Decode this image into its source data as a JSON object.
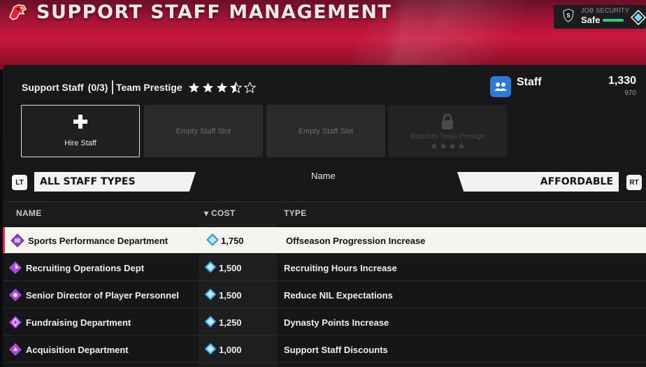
{
  "header": {
    "title": "SUPPORT STAFF MANAGEMENT",
    "job_security": {
      "label": "JOB SECURITY",
      "value": "Safe",
      "bar_level": 0.6,
      "bar_color": "#2fd07a"
    },
    "accent_color": "#c8183f"
  },
  "summary": {
    "staff_label": "Support Staff",
    "staff_count": "(0/3)",
    "prestige_label": "Team Prestige",
    "prestige_stars": 3.5,
    "prestige_max": 5
  },
  "currency": {
    "label": "Staff",
    "icon": "staff-icon",
    "total": "1,330",
    "sub": "970",
    "badge_color": "#2e78d8"
  },
  "slots": [
    {
      "label": "Hire Staff",
      "icon": "plus-icon"
    },
    {
      "label": "Empty Staff Slot"
    },
    {
      "label": "Empty Staff Slot"
    },
    {
      "label": "Requires Team Prestige",
      "icon": "lock-icon",
      "stars": 4
    }
  ],
  "filters": {
    "left_trigger": "LT",
    "left_value": "ALL STAFF TYPES",
    "sort_label": "Name",
    "right_value": "AFFORDABLE",
    "right_trigger": "RT"
  },
  "table": {
    "columns": [
      "NAME",
      "COST",
      "TYPE"
    ],
    "sort_indicator": "▾",
    "rows": [
      {
        "name": "Sports Performance Department",
        "cost": "1,750",
        "type": "Offseason Progression Increase",
        "selected": true
      },
      {
        "name": "Recruiting Operations Dept",
        "cost": "1,500",
        "type": "Recruiting Hours Increase"
      },
      {
        "name": "Senior Director of Player Personnel",
        "cost": "1,500",
        "type": "Reduce NIL Expectations"
      },
      {
        "name": "Fundraising Department",
        "cost": "1,250",
        "type": "Dynasty Points Increase"
      },
      {
        "name": "Acquisition Department",
        "cost": "1,000",
        "type": "Support Staff Discounts"
      }
    ]
  }
}
